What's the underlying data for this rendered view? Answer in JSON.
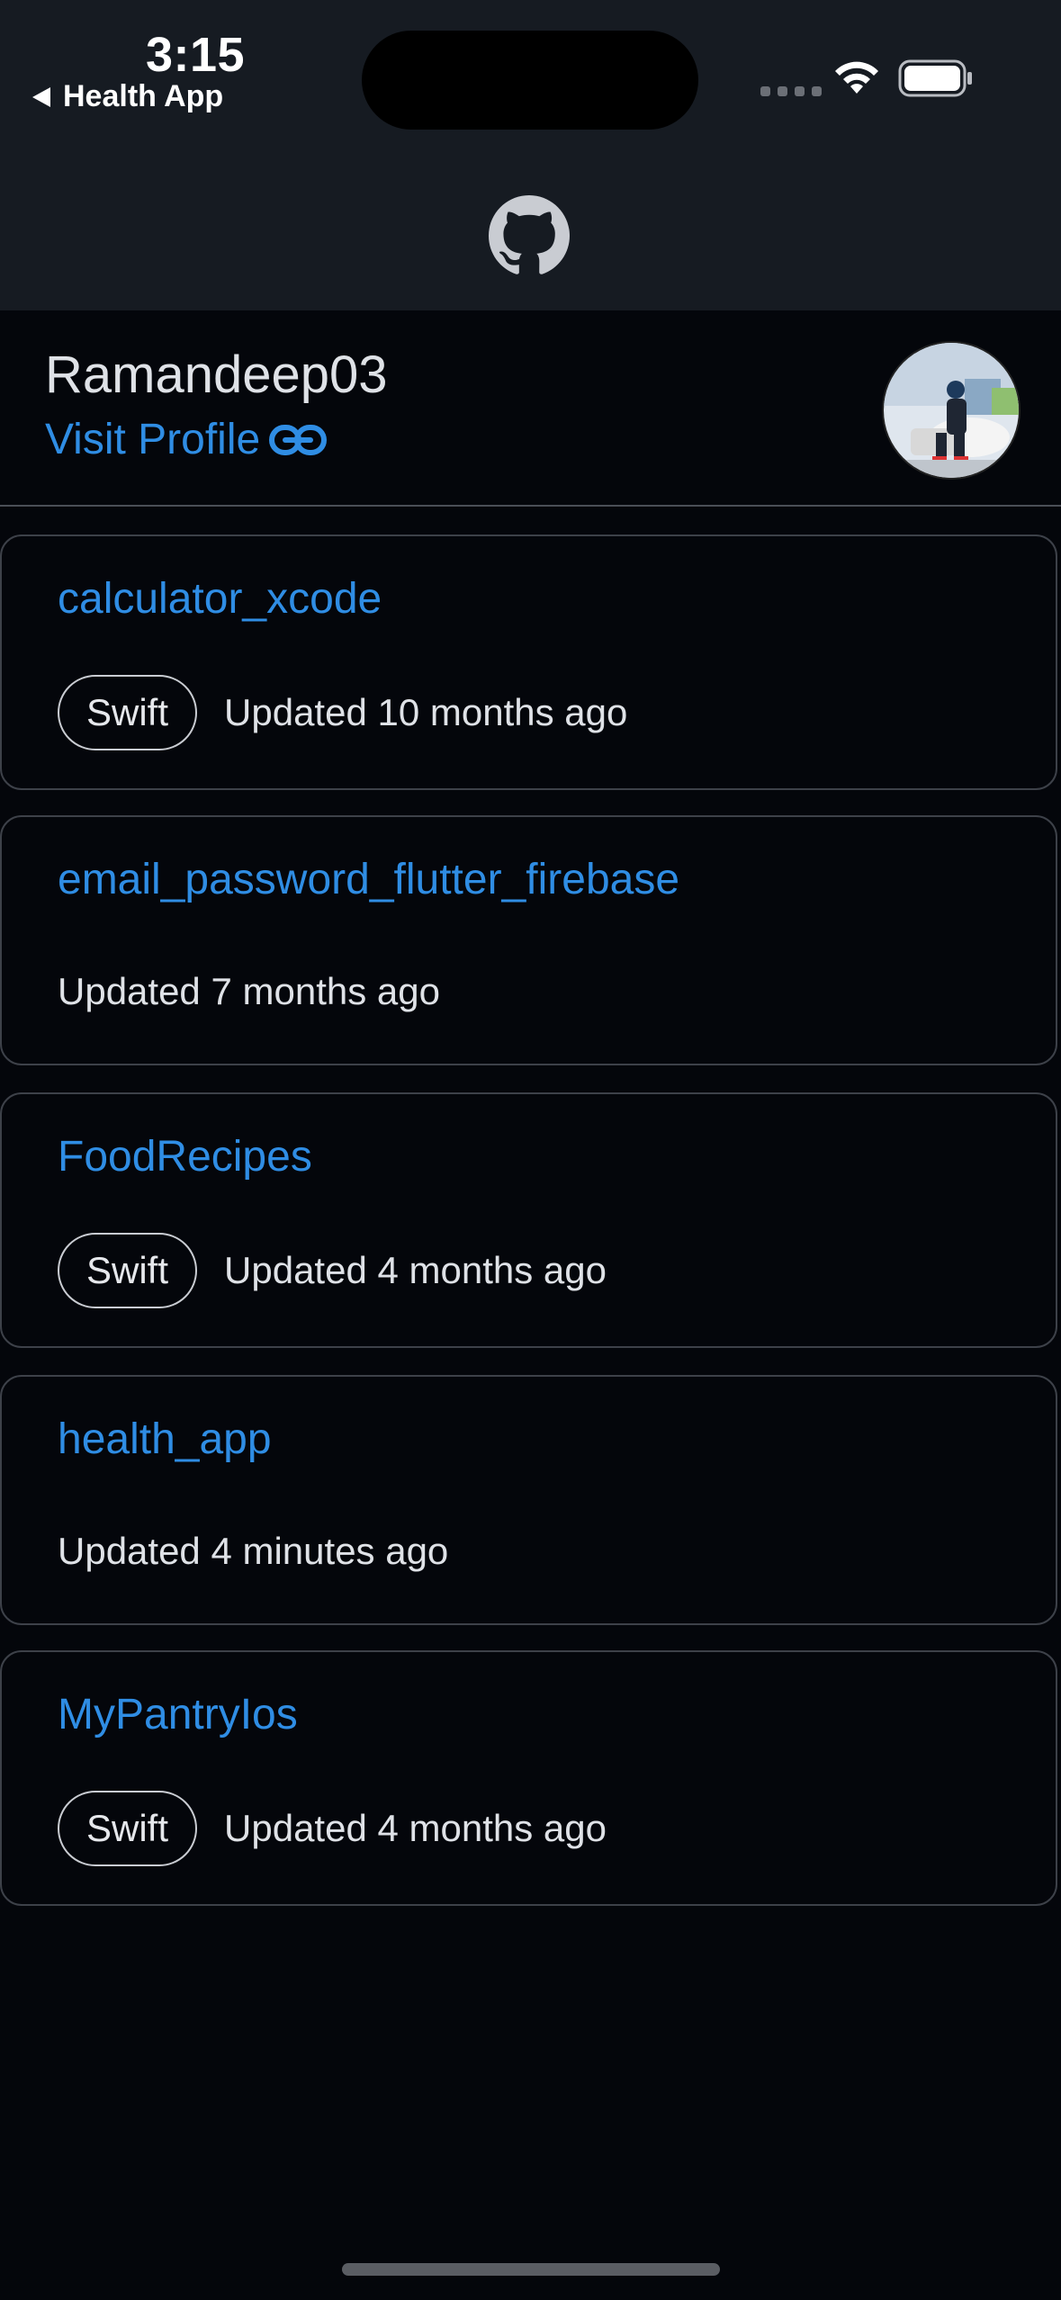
{
  "status_bar": {
    "time": "3:15",
    "back_app": "Health App"
  },
  "header": {
    "logo_icon": "github-icon"
  },
  "profile": {
    "username": "Ramandeep03",
    "visit_label": "Visit Profile",
    "link_icon": "link-icon"
  },
  "repos": [
    {
      "name": "calculator_xcode",
      "language": "Swift",
      "updated": "Updated 10 months ago"
    },
    {
      "name": "email_password_flutter_firebase",
      "language": "",
      "updated": "Updated 7 months ago"
    },
    {
      "name": "FoodRecipes",
      "language": "Swift",
      "updated": "Updated 4 months ago"
    },
    {
      "name": "health_app",
      "language": "",
      "updated": "Updated 4 minutes ago"
    },
    {
      "name": "MyPantryIos",
      "language": "Swift",
      "updated": "Updated 4 months ago"
    }
  ],
  "colors": {
    "accent": "#2f8de4",
    "background": "#04060b",
    "header_bg": "#161b22"
  }
}
